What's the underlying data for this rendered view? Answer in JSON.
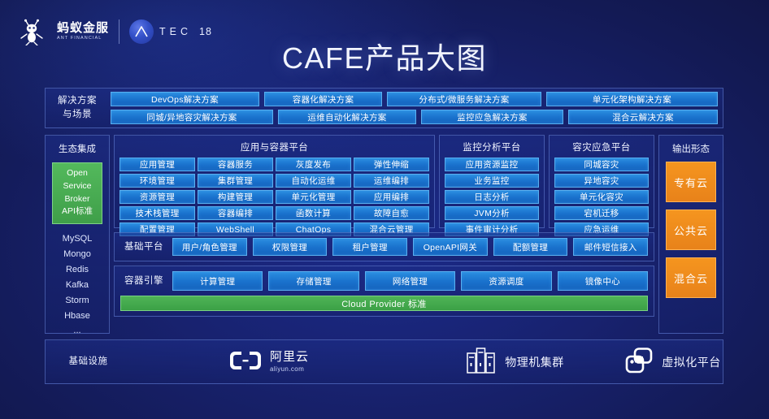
{
  "brand": {
    "ant_cn": "蚂蚁金服",
    "ant_en": "ANT FINANCIAL",
    "atec_letters": "TEC",
    "atec_number": "18"
  },
  "title": "CAFE产品大图",
  "solutions": {
    "label": "解决方案\n与场景",
    "row1": [
      "DevOps解决方案",
      "容器化解决方案",
      "分布式/微服务解决方案",
      "单元化架构解决方案"
    ],
    "row2": [
      "同城/异地容灾解决方案",
      "运维自动化解决方案",
      "监控应急解决方案",
      "混合云解决方案"
    ]
  },
  "eco": {
    "title": "生态集成",
    "green_box": "Open\nService\nBroker\nAPI标准",
    "list": [
      "MySQL",
      "Mongo",
      "Redis",
      "Kafka",
      "Storm",
      "Hbase",
      "..."
    ]
  },
  "app_platform": {
    "title": "应用与容器平台",
    "items": [
      "应用管理",
      "容器服务",
      "灰度发布",
      "弹性伸缩",
      "环境管理",
      "集群管理",
      "自动化运维",
      "运维编排",
      "资源管理",
      "构建管理",
      "单元化管理",
      "应用编排",
      "技术栈管理",
      "容器编排",
      "函数计算",
      "故障自愈",
      "配置管理",
      "WebShell",
      "ChatOps",
      "混合云管理"
    ]
  },
  "monitor_platform": {
    "title": "监控分析平台",
    "items": [
      "应用资源监控",
      "业务监控",
      "日志分析",
      "JVM分析",
      "事件审计分析"
    ]
  },
  "dr_platform": {
    "title": "容灾应急平台",
    "items": [
      "同城容灾",
      "异地容灾",
      "单元化容灾",
      "宕机迁移",
      "应急运维"
    ]
  },
  "base_platform": {
    "label": "基础平台",
    "items": [
      "用户/角色管理",
      "权限管理",
      "租户管理",
      "OpenAPI网关",
      "配额管理",
      "邮件短信接入"
    ]
  },
  "container_engine": {
    "label": "容器引擎",
    "items": [
      "计算管理",
      "存储管理",
      "网络管理",
      "资源调度",
      "镜像中心"
    ],
    "cloud_provider_bar": "Cloud Provider 标准"
  },
  "output": {
    "title": "输出形态",
    "items": [
      "专有云",
      "公共云",
      "混合云"
    ]
  },
  "infrastructure": {
    "label": "基础设施",
    "aliyun_cn": "阿里云",
    "aliyun_en": "aliyun.com",
    "physical_label": "物理机集群",
    "virtual_label": "虚拟化平台"
  },
  "colors": {
    "background": "#141a54",
    "cell_blue": "#1a72cd",
    "accent_green": "#3ba046",
    "accent_orange": "#e8821a"
  }
}
